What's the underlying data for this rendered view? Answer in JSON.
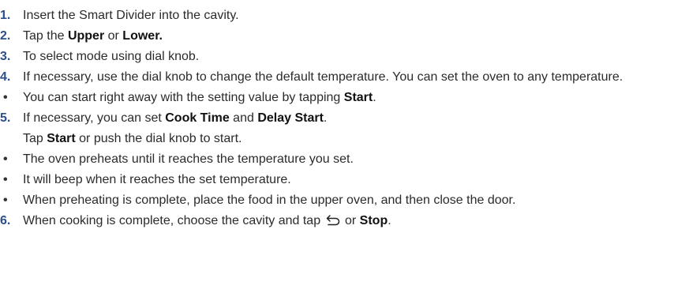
{
  "steps": [
    {
      "num": "1.",
      "parts": [
        "Insert the Smart Divider into the cavity."
      ]
    },
    {
      "num": "2.",
      "parts": [
        "Tap the ",
        "Upper",
        " or ",
        "Lower."
      ]
    },
    {
      "num": "3.",
      "parts": [
        "To select mode using dial knob."
      ]
    },
    {
      "num": "4.",
      "parts": [
        "If necessary, use the dial knob to change the default temperature. You can set the oven to any temperature."
      ],
      "bullets": [
        {
          "parts": [
            "You can start right away with the setting value by tapping ",
            "Start",
            "."
          ]
        }
      ]
    },
    {
      "num": "5.",
      "parts": [
        "If necessary, you can set ",
        "Cook Time",
        " and ",
        "Delay Start",
        "."
      ],
      "second_line": [
        "Tap ",
        "Start",
        " or push the dial knob to start."
      ],
      "bullets": [
        {
          "parts": [
            "The oven preheats until it reaches the temperature you set."
          ]
        },
        {
          "parts": [
            "It will beep when it reaches the set temperature."
          ]
        },
        {
          "parts": [
            "When preheating is complete, place the food in the upper oven, and then close the door."
          ]
        }
      ]
    },
    {
      "num": "6.",
      "parts": [
        "When cooking is complete, choose the cavity and tap ",
        " or ",
        "Stop",
        "."
      ],
      "icon": "back-arrow-icon"
    }
  ],
  "bullet_char": "•",
  "colors": {
    "number": "#2d4f8a",
    "text": "#2b2b2b",
    "bold": "#111111"
  }
}
